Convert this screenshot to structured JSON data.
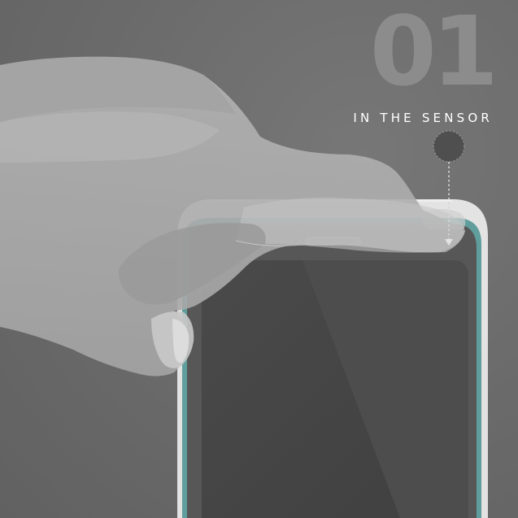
{
  "step": {
    "number": "01",
    "caption": "IN THE SENSOR"
  },
  "icons": {
    "sensor_target": "sensor-target-icon",
    "arrow": "dotted-down-arrow-icon",
    "speaker": "earpiece-speaker-icon",
    "camera": "front-camera-icon"
  },
  "colors": {
    "background": "#6b6b6b",
    "step_number": "#8e8e8e",
    "caption": "#ffffff",
    "phone_accent": "#5f9e9c",
    "screen": "#474747"
  }
}
